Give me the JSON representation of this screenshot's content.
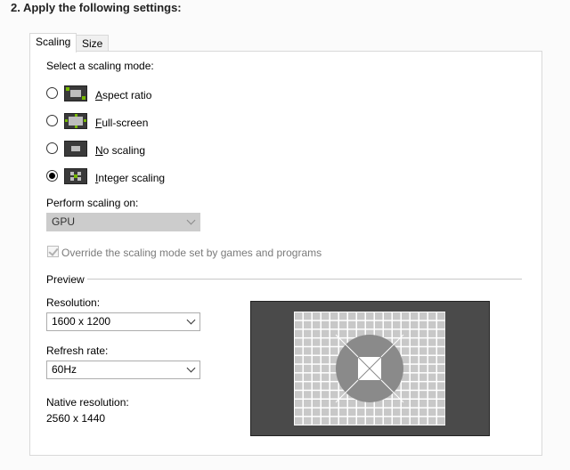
{
  "heading": "2. Apply the following settings:",
  "tabs": [
    {
      "label": "Scaling",
      "active": true
    },
    {
      "label": "Size",
      "active": false
    }
  ],
  "scaling": {
    "select_mode_label": "Select a scaling mode:",
    "modes": [
      {
        "mnemonic": "A",
        "rest": "spect ratio",
        "checked": false,
        "icon": "aspect-ratio-icon"
      },
      {
        "mnemonic": "F",
        "rest": "ull-screen",
        "checked": false,
        "icon": "full-screen-icon"
      },
      {
        "mnemonic": "N",
        "rest": "o scaling",
        "checked": false,
        "icon": "no-scaling-icon"
      },
      {
        "mnemonic": "I",
        "rest": "nteger scaling",
        "checked": true,
        "icon": "integer-scaling-icon"
      }
    ],
    "perform_on_label": "Perform scaling on:",
    "perform_on_value": "GPU",
    "override_label": "Override the scaling mode set by games and programs",
    "override_checked": true
  },
  "preview": {
    "section_label": "Preview",
    "resolution_label": "Resolution:",
    "resolution_value": "1600 x 1200",
    "refresh_label": "Refresh rate:",
    "refresh_value": "60Hz",
    "native_label": "Native resolution:",
    "native_value": "2560 x 1440"
  },
  "colors": {
    "preview_bg": "#4a4a4a",
    "preview_grid": "#c8c8c8",
    "preview_circle": "#8a8a8a",
    "icon_accent": "#76b900"
  }
}
